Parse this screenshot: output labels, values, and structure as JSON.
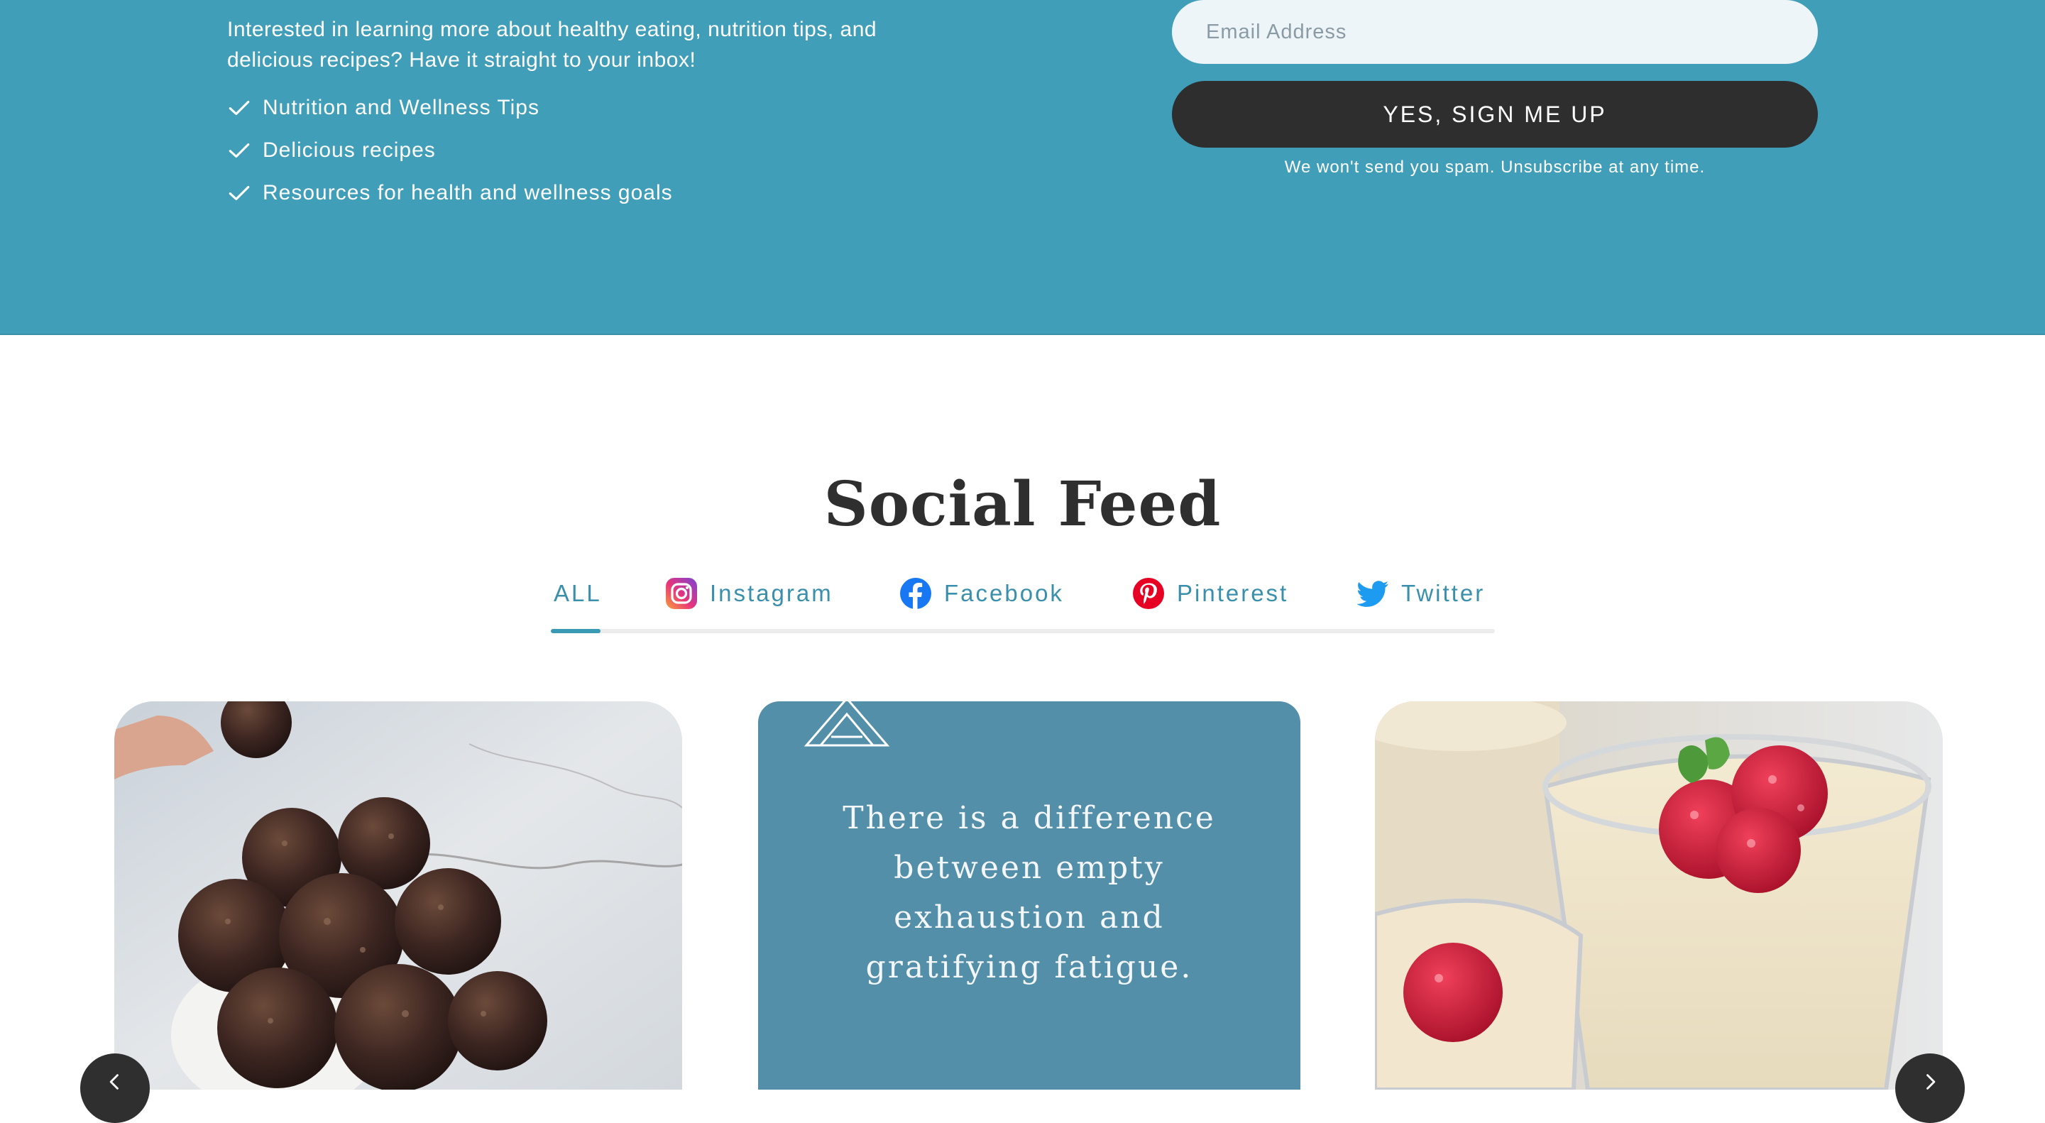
{
  "newsletter": {
    "intro": "Interested in learning more about healthy eating, nutrition tips, and delicious recipes? Have it straight to your inbox!",
    "benefits": [
      {
        "label": "Nutrition and Wellness Tips",
        "icon": "check-icon"
      },
      {
        "label": "Delicious recipes",
        "icon": "check-icon"
      },
      {
        "label": "Resources for health and wellness goals",
        "icon": "check-icon"
      }
    ],
    "email_placeholder": "Email Address",
    "email_value": "",
    "submit_label": "YES, SIGN ME UP",
    "disclaimer": "We won't send you spam. Unsubscribe at any time.",
    "background_color": "#419eb8"
  },
  "social_feed": {
    "title": "Social Feed",
    "tabs": [
      {
        "label": "ALL",
        "icon": null,
        "active": true
      },
      {
        "label": "Instagram",
        "icon": "instagram-icon",
        "active": false
      },
      {
        "label": "Facebook",
        "icon": "facebook-icon",
        "active": false
      },
      {
        "label": "Pinterest",
        "icon": "pinterest-icon",
        "active": false
      },
      {
        "label": "Twitter",
        "icon": "twitter-icon",
        "active": false
      }
    ],
    "accent_color": "#3a9ab4",
    "cards": [
      {
        "type": "image",
        "subject": "chocolate-oat-energy-balls"
      },
      {
        "type": "quote",
        "quote": "There is a difference between empty exhaustion and gratifying fatigue.",
        "background_color": "#548fa9"
      },
      {
        "type": "image",
        "subject": "raspberry-pudding-cups"
      }
    ],
    "controls": {
      "prev_icon": "chevron-left-icon",
      "next_icon": "chevron-right-icon"
    }
  }
}
